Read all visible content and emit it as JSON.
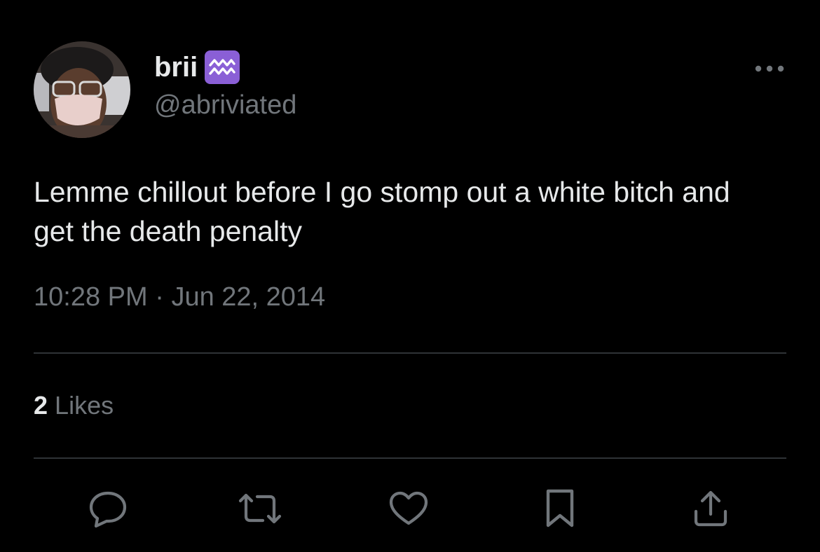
{
  "author": {
    "display_name": "brii",
    "zodiac_badge": "♒",
    "handle": "@abriviated",
    "badge_color": "#8a5fd6"
  },
  "tweet": {
    "text": "Lemme chillout before I go stomp out a white bitch and get the death penalty",
    "time": "10:28 PM",
    "separator": "·",
    "date": "Jun 22, 2014"
  },
  "stats": {
    "likes_count": "2",
    "likes_label": "Likes"
  },
  "actions": {
    "reply_icon": "reply-icon",
    "retweet_icon": "retweet-icon",
    "like_icon": "heart-icon",
    "bookmark_icon": "bookmark-icon",
    "share_icon": "share-icon"
  },
  "theme": {
    "background": "#000000",
    "text_primary": "#e7e9ea",
    "text_secondary": "#71767b",
    "divider": "#2f3336"
  }
}
